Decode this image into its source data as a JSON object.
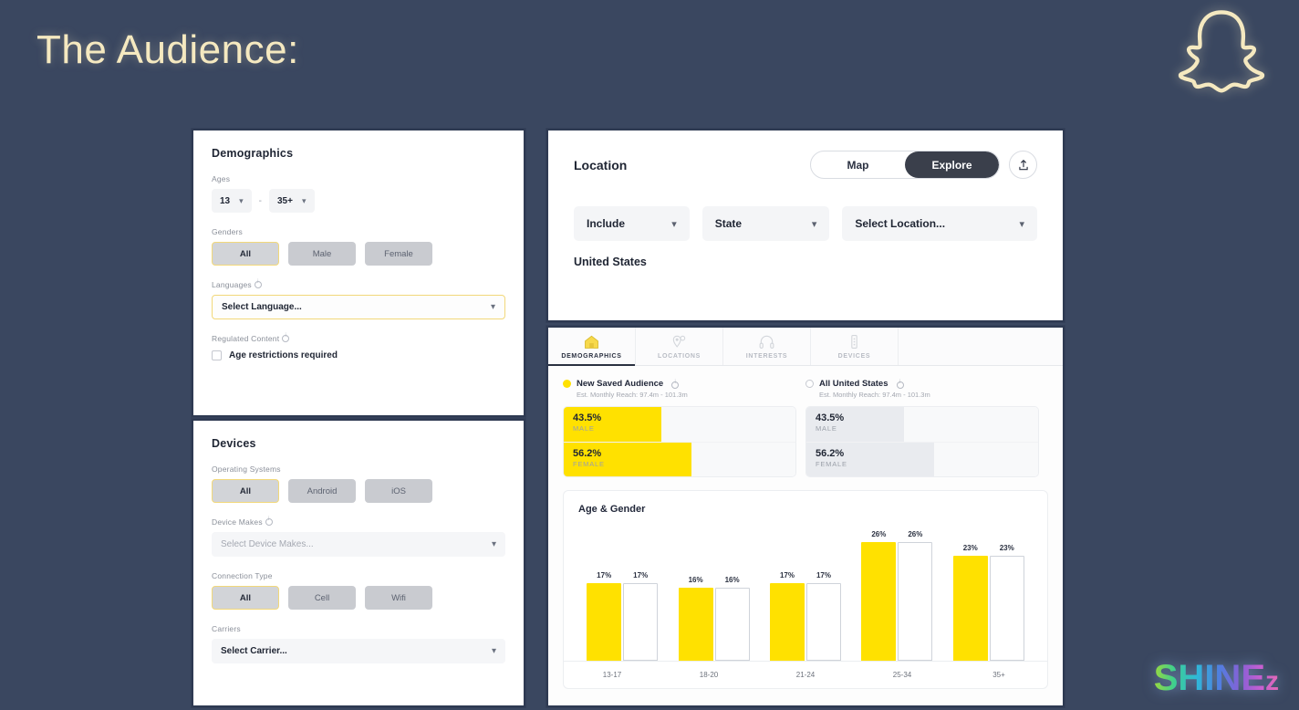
{
  "slide": {
    "title": "The Audience:",
    "brand_logo": "SHINE",
    "brand_logo_suffix": "z",
    "ghost_icon": "snapchat-ghost-icon",
    "bg_color": "#3a4760",
    "title_color": "#f5e9c0",
    "accent_yellow": "#ffe100"
  },
  "demographics": {
    "title": "Demographics",
    "ages": {
      "label": "Ages",
      "min": "13",
      "max": "35+",
      "separator": "-",
      "chevron": "⌄"
    },
    "genders": {
      "label": "Genders",
      "options": [
        {
          "label": "All",
          "selected": true
        },
        {
          "label": "Male",
          "selected": false
        },
        {
          "label": "Female",
          "selected": false
        }
      ]
    },
    "languages": {
      "label": "Languages",
      "placeholder": "Select Language...",
      "value": "Select Language..."
    },
    "regulated_content": {
      "label": "Regulated Content",
      "checkbox_label": "Age restrictions required",
      "checked": false
    }
  },
  "devices": {
    "title": "Devices",
    "operating_systems": {
      "label": "Operating Systems",
      "options": [
        {
          "label": "All",
          "selected": true
        },
        {
          "label": "Android",
          "selected": false
        },
        {
          "label": "iOS",
          "selected": false
        }
      ]
    },
    "device_makes": {
      "label": "Device Makes",
      "placeholder": "Select Device Makes...",
      "value": "Select Device Makes..."
    },
    "connection_type": {
      "label": "Connection Type",
      "options": [
        {
          "label": "All",
          "selected": true
        },
        {
          "label": "Cell",
          "selected": false
        },
        {
          "label": "Wifi",
          "selected": false
        }
      ]
    },
    "carriers": {
      "label": "Carriers",
      "placeholder": "Select Carrier...",
      "value": "Select Carrier..."
    }
  },
  "location": {
    "title": "Location",
    "view_toggle": [
      {
        "label": "Map",
        "active": false
      },
      {
        "label": "Explore",
        "active": true
      }
    ],
    "upload_icon": "upload-icon",
    "filters": {
      "include": "Include",
      "state": "State",
      "select_location": "Select Location..."
    },
    "selected_value": "United States"
  },
  "insights": {
    "tabs": [
      {
        "label": "DEMOGRAPHICS",
        "icon": "house-icon",
        "active": true
      },
      {
        "label": "LOCATIONS",
        "icon": "map-pin-icon",
        "active": false
      },
      {
        "label": "INTERESTS",
        "icon": "headphones-icon",
        "active": false
      },
      {
        "label": "DEVICES",
        "icon": "mobile-device-icon",
        "active": false
      }
    ],
    "audiences": [
      {
        "name": "New Saved Audience",
        "reach": "Est. Monthly Reach: 97.4m - 101.3m",
        "selected": true,
        "bars": [
          {
            "pct_label": "43.5%",
            "group": "MALE",
            "value": 43.5
          },
          {
            "pct_label": "56.2%",
            "group": "FEMALE",
            "value": 56.2
          }
        ]
      },
      {
        "name": "All United States",
        "reach": "Est. Monthly Reach: 97.4m - 101.3m",
        "selected": false,
        "bars": [
          {
            "pct_label": "43.5%",
            "group": "MALE",
            "value": 43.5
          },
          {
            "pct_label": "56.2%",
            "group": "FEMALE",
            "value": 56.2
          }
        ]
      }
    ]
  },
  "chart_data": {
    "type": "bar",
    "title": "Age & Gender",
    "categories": [
      "13-17",
      "18-20",
      "21-24",
      "25-34",
      "35+"
    ],
    "series": [
      {
        "name": "New Saved Audience",
        "color": "#ffe100",
        "values": [
          17,
          16,
          17,
          26,
          23
        ]
      },
      {
        "name": "All United States",
        "color": "#ffffff",
        "values": [
          17,
          16,
          17,
          26,
          23
        ]
      }
    ],
    "value_labels": [
      [
        "17%",
        "17%"
      ],
      [
        "16%",
        "16%"
      ],
      [
        "17%",
        "17%"
      ],
      [
        "26%",
        "26%"
      ],
      [
        "23%",
        "23%"
      ]
    ],
    "xlabel": "",
    "ylabel": "",
    "ylim": [
      0,
      30
    ],
    "grid": false,
    "legend": "none"
  }
}
